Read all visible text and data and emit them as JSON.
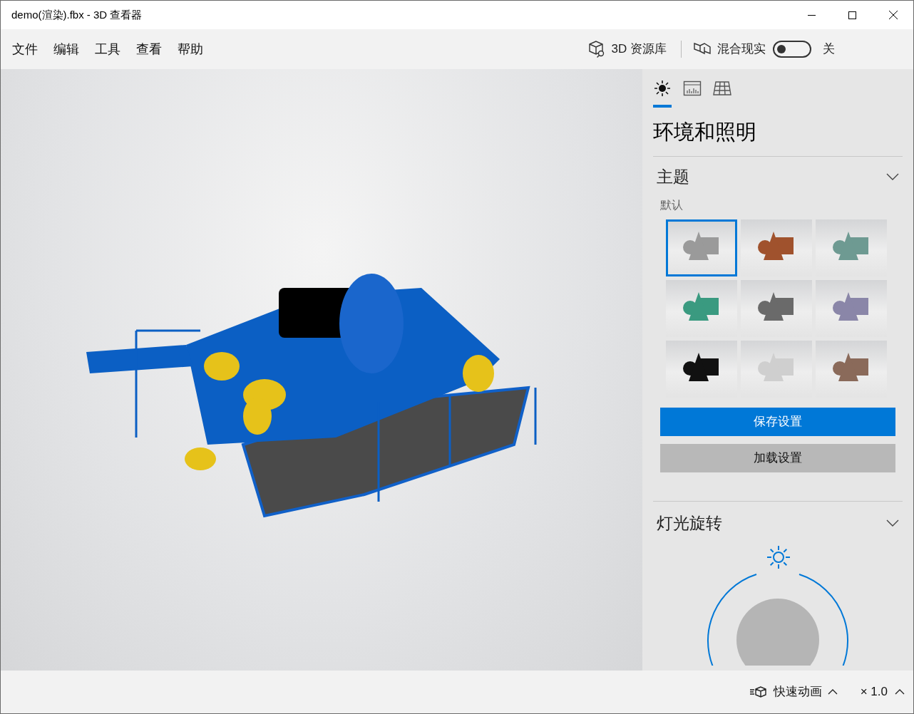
{
  "window": {
    "title": "demo(渲染).fbx - 3D 查看器"
  },
  "menu": [
    "文件",
    "编辑",
    "工具",
    "查看",
    "帮助"
  ],
  "toolbar": {
    "library": "3D 资源库",
    "mixed_reality": {
      "label": "混合现实",
      "on": false,
      "state_text": "关"
    }
  },
  "panel": {
    "tabs": [
      {
        "kind": "lighting",
        "selected": true
      },
      {
        "kind": "stats",
        "selected": false
      },
      {
        "kind": "grid",
        "selected": false
      }
    ],
    "title": "环境和照明",
    "theme": {
      "header": "主题",
      "expanded": true,
      "current": "默认",
      "swatches": [
        {
          "color": "#9a9a9a",
          "selected": true
        },
        {
          "color": "#a0522d",
          "selected": false
        },
        {
          "color": "#6e9a92",
          "selected": false
        },
        {
          "color": "#3a9a80",
          "selected": false
        },
        {
          "color": "#6a6a6a",
          "selected": false
        },
        {
          "color": "#8a86a8",
          "selected": false
        },
        {
          "color": "#111111",
          "selected": false
        },
        {
          "color": "#cfcfcf",
          "selected": false
        },
        {
          "color": "#8a6a5a",
          "selected": false
        }
      ],
      "save": "保存设置",
      "load": "加载设置"
    },
    "light": {
      "header": "灯光旋转",
      "expanded": true
    }
  },
  "bottom": {
    "animation": "快速动画",
    "speed": "× 1.0"
  }
}
